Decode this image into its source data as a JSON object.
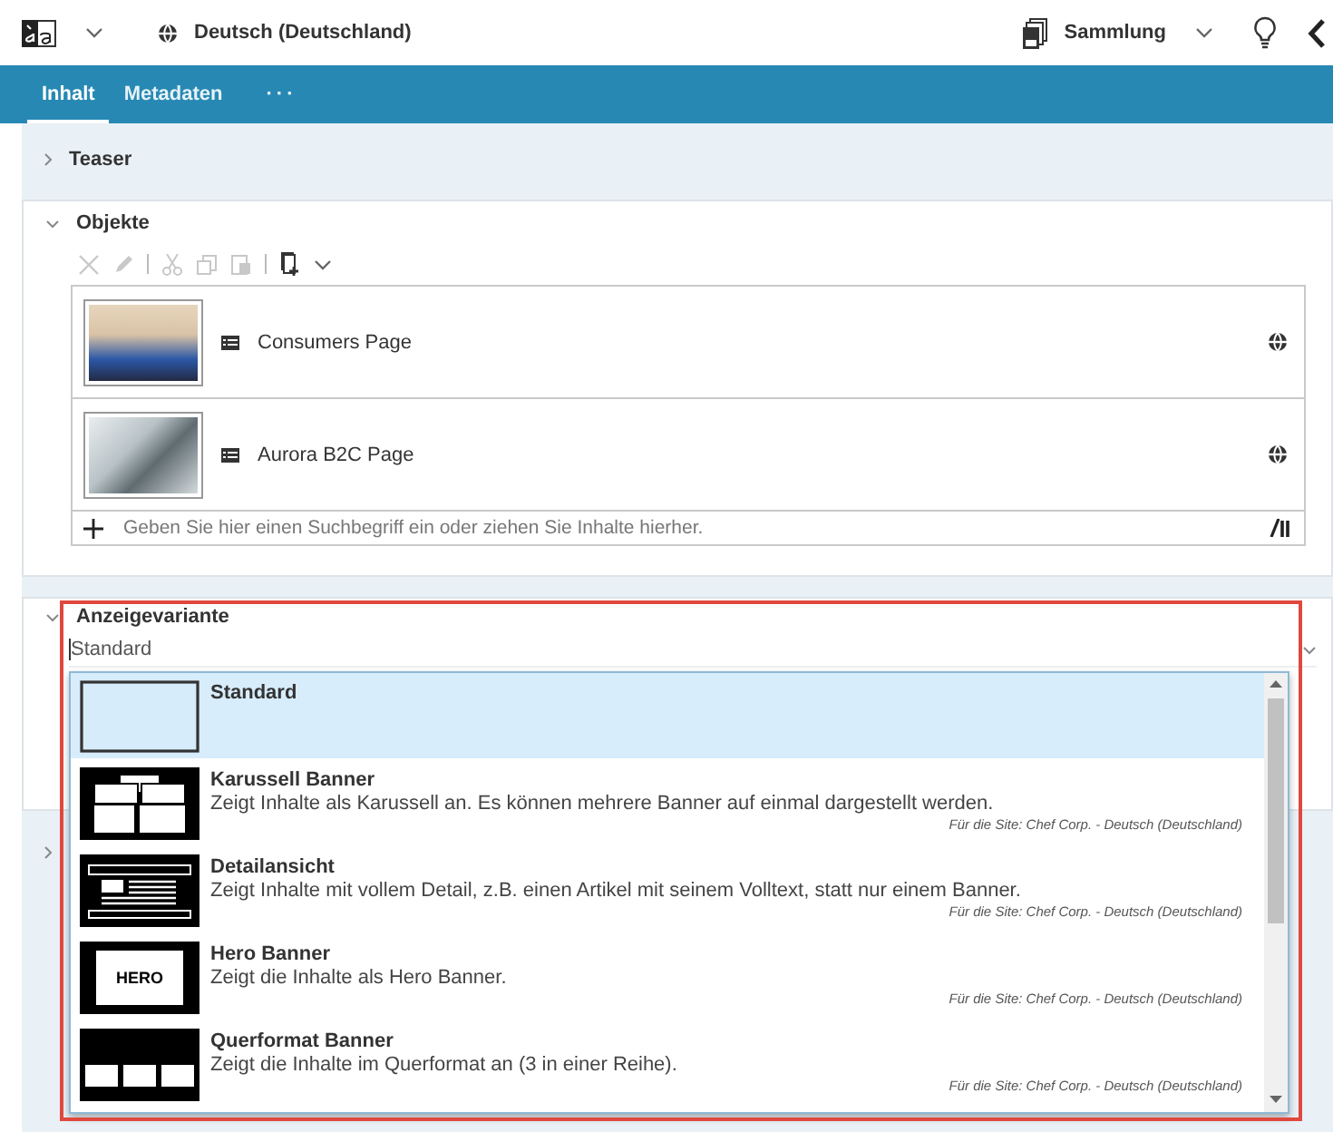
{
  "header": {
    "language": "Deutsch (Deutschland)",
    "collection": "Sammlung"
  },
  "tabs": [
    {
      "label": "Inhalt",
      "selected": true
    },
    {
      "label": "Metadaten",
      "selected": false
    },
    {
      "label": "···",
      "selected": false
    }
  ],
  "teaser": {
    "title": "Teaser",
    "expanded": false
  },
  "objekte": {
    "title": "Objekte",
    "expanded": true,
    "actions": [
      {
        "kind": "delete",
        "disabled": true
      },
      {
        "kind": "edit",
        "disabled": true
      },
      {
        "kind": "cut",
        "disabled": true
      },
      {
        "kind": "copy",
        "disabled": true
      },
      {
        "kind": "paste",
        "disabled": true
      },
      {
        "kind": "add",
        "disabled": false
      }
    ],
    "items": [
      {
        "title": "Consumers Page"
      },
      {
        "title": "Aurora B2C Page"
      }
    ],
    "search_placeholder": "Geben Sie hier einen Suchbegriff ein oder ziehen Sie Inhalte hierher."
  },
  "anzeigevariante": {
    "title": "Anzeigevariante",
    "expanded": true,
    "value": "Standard",
    "options": [
      {
        "kind": "standard",
        "title": "Standard",
        "selected": true
      },
      {
        "kind": "carousel",
        "title": "Karussell Banner",
        "description": "Zeigt Inhalte als Karussell an. Es können mehrere Banner auf einmal dargestellt werden.",
        "site": "Für die Site: Chef Corp. - Deutsch (Deutschland)",
        "selected": false
      },
      {
        "kind": "detail",
        "title": "Detailansicht",
        "description": "Zeigt Inhalte mit vollem Detail, z.B. einen Artikel mit seinem Volltext, statt nur einem Banner.",
        "site": "Für die Site: Chef Corp. - Deutsch (Deutschland)",
        "selected": false
      },
      {
        "kind": "hero",
        "title": "Hero Banner",
        "thumb_label": "HERO",
        "description": "Zeigt die Inhalte als Hero Banner.",
        "site": "Für die Site: Chef Corp. - Deutsch (Deutschland)",
        "selected": false
      },
      {
        "kind": "landscape",
        "title": "Querformat Banner",
        "description": "Zeigt die Inhalte im Querformat an (3 in einer Reihe).",
        "site": "Für die Site: Chef Corp. - Deutsch (Deutschland)",
        "selected": false
      }
    ]
  },
  "next_section": {
    "expanded": false
  }
}
